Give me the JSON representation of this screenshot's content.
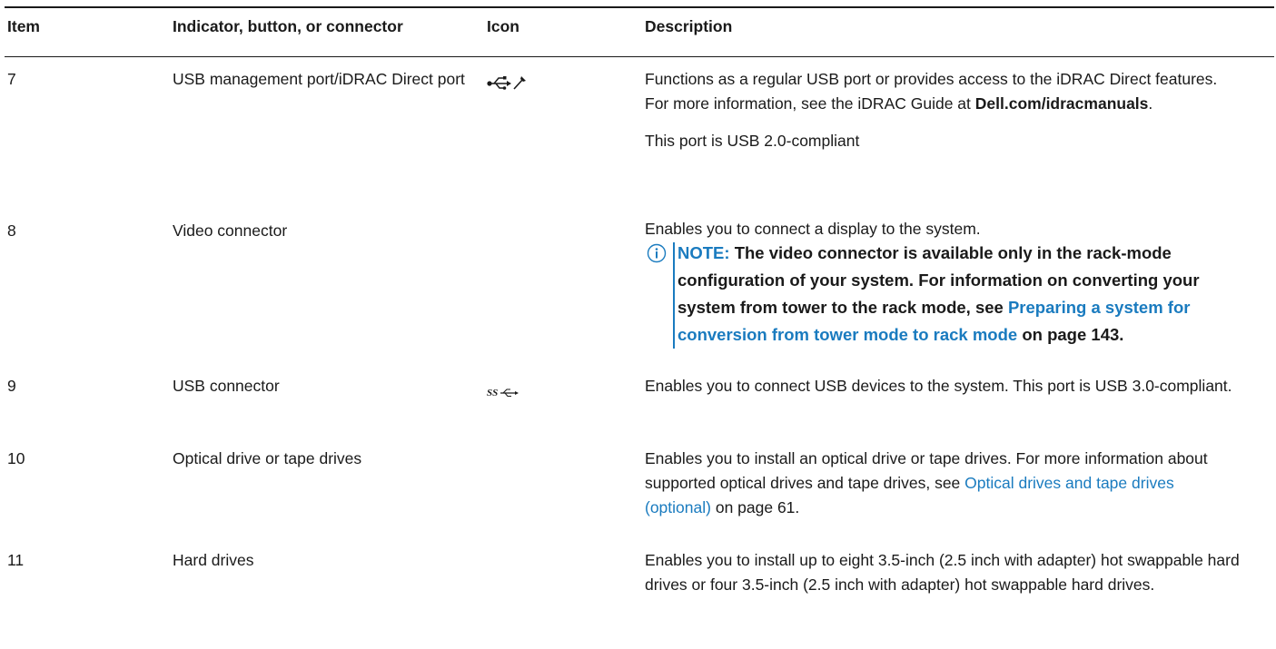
{
  "header": {
    "item": "Item",
    "indicator": "Indicator, button, or connector",
    "icon": "Icon",
    "description": "Description"
  },
  "rows": [
    {
      "item": "7",
      "indicator": "USB management port/iDRAC Direct port",
      "icon": "usb-management-icon",
      "desc_1_pre": "Functions as a regular USB port or provides access to the iDRAC Direct features. For more information, see the iDRAC Guide at ",
      "desc_1_link": "Dell.com/idracmanuals",
      "desc_1_post": ".",
      "desc_2": "This port is USB 2.0-compliant"
    },
    {
      "item": "8",
      "indicator": "Video connector",
      "icon": "",
      "desc": "Enables you to connect a display to the system.",
      "note_label": "NOTE:",
      "note_text_1": " The video connector is available only in the rack-mode configuration of your system. For information on converting your system from tower to the rack mode, see ",
      "note_link": "Preparing a system for conversion from tower mode to rack mode",
      "note_text_2": " on page 143."
    },
    {
      "item": "9",
      "indicator": "USB connector",
      "icon": "usb-superspeed-icon",
      "desc": "Enables you to connect USB devices to the system. This port is USB 3.0-compliant."
    },
    {
      "item": "10",
      "indicator": "Optical drive or tape drives",
      "icon": "",
      "desc_pre": "Enables you to install an optical drive or tape drives. For more information about supported optical drives and tape drives, see ",
      "desc_link": "Optical drives and tape drives (optional)",
      "desc_post": " on page 61."
    },
    {
      "item": "11",
      "indicator": "Hard drives",
      "icon": "",
      "desc": "Enables you to install up to eight 3.5-inch (2.5 inch with adapter) hot swappable hard drives or four 3.5-inch (2.5 inch with adapter) hot swappable hard drives."
    }
  ],
  "colors": {
    "link": "#1a7bbf",
    "text": "#1a1a1a"
  }
}
